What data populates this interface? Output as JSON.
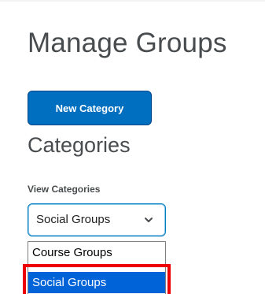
{
  "page": {
    "title": "Manage Groups"
  },
  "actions": {
    "new_category_label": "New Category"
  },
  "categories": {
    "heading": "Categories",
    "view_label": "View Categories",
    "selected_value": "Social Groups",
    "options": [
      {
        "label": "Course Groups",
        "selected": false
      },
      {
        "label": "Social Groups",
        "selected": true
      }
    ]
  },
  "colors": {
    "primary_button": "#006fbf",
    "selected_option": "#0063d8",
    "highlight_annotation": "#ee0000"
  },
  "icons": {
    "dropdown": "chevron-down-icon"
  }
}
